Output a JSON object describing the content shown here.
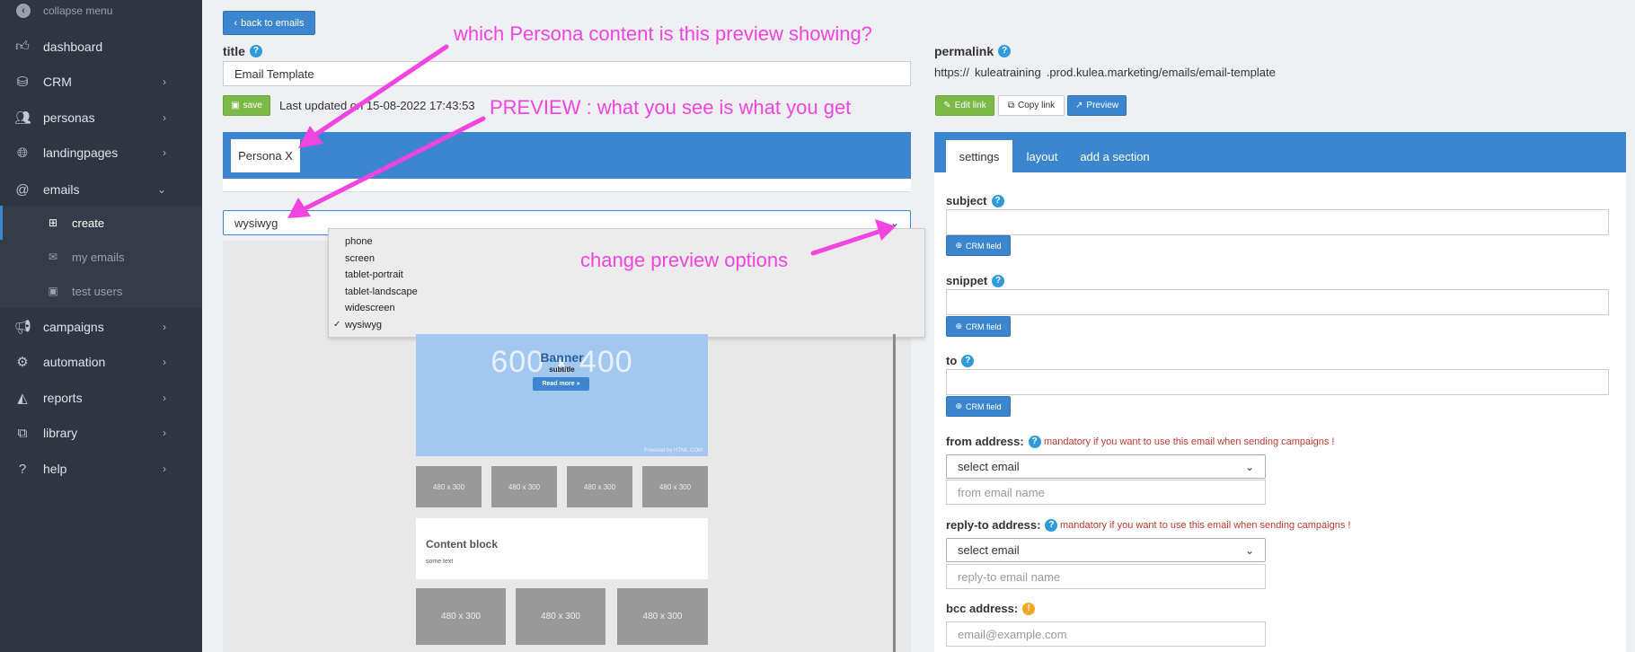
{
  "sidebar": {
    "collapse_label": "collapse menu",
    "items": [
      {
        "label": "dashboard",
        "icon": "thumbs-up-icon",
        "chevron": ""
      },
      {
        "label": "CRM",
        "icon": "database-icon",
        "chevron": "›"
      },
      {
        "label": "personas",
        "icon": "users-icon",
        "chevron": "›"
      },
      {
        "label": "landingpages",
        "icon": "globe-icon",
        "chevron": "›"
      },
      {
        "label": "emails",
        "icon": "at-icon",
        "chevron": "⌄"
      },
      {
        "label": "create",
        "icon": "plus-square-icon",
        "chevron": ""
      },
      {
        "label": "my emails",
        "icon": "envelope-icon",
        "chevron": ""
      },
      {
        "label": "test users",
        "icon": "id-card-icon",
        "chevron": ""
      },
      {
        "label": "campaigns",
        "icon": "megaphone-icon",
        "chevron": "›"
      },
      {
        "label": "automation",
        "icon": "gears-icon",
        "chevron": "›"
      },
      {
        "label": "reports",
        "icon": "area-chart-icon",
        "chevron": "›"
      },
      {
        "label": "library",
        "icon": "copy-icon",
        "chevron": "›"
      },
      {
        "label": "help",
        "icon": "question-circle-icon",
        "chevron": "›"
      }
    ]
  },
  "main": {
    "back_label": "back to emails",
    "title_label": "title",
    "title_value": "Email Template",
    "save_label": "save",
    "last_updated": "Last updated on 15-08-2022 17:43:53",
    "persona_label": "Persona X",
    "preview_select": "wysiwyg",
    "preview_options": [
      "phone",
      "screen",
      "tablet-portrait",
      "tablet-landscape",
      "widescreen",
      "wysiwyg"
    ],
    "preview_selected_mark": "✓",
    "banner": {
      "size_text": "600 x 400",
      "title": "Banner",
      "subtitle": "subtitle",
      "button": "Read more »",
      "footer": "Powered by HTML.COM"
    },
    "thumbs_small": [
      "480 x 300",
      "480 x 300",
      "480 x 300",
      "480 x 300"
    ],
    "content_block_title": "Content block",
    "content_block_text": "some text",
    "thumbs_large": [
      "480 x 300",
      "480 x 300",
      "480 x 300"
    ]
  },
  "right": {
    "permalink_label": "permalink",
    "permalink_prefix": "https://",
    "permalink_sub": "kuleatraining",
    "permalink_rest": ".prod.kulea.marketing/emails/email-template",
    "edit_link": "Edit link",
    "copy_link": "Copy link",
    "preview": "Preview",
    "tabs": [
      "settings",
      "layout",
      "add a section"
    ],
    "subject_label": "subject",
    "snippet_label": "snippet",
    "to_label": "to",
    "crm_field": "CRM field",
    "from_label": "from address:",
    "from_note": "mandatory if you want to use this email when sending campaigns !",
    "select_email": "select email",
    "from_name_placeholder": "from email name",
    "reply_label": "reply-to address:",
    "reply_note": "mandatory if you want to use this email when sending campaigns !",
    "reply_name_placeholder": "reply-to email name",
    "bcc_label": "bcc address:",
    "bcc_placeholder": "email@example.com"
  },
  "annotations": {
    "persona_question": "which Persona content is this preview showing?",
    "preview_note": "PREVIEW : what you see is what you get",
    "options_note": "change preview options",
    "color": "#f244e0"
  },
  "colors": {
    "sidebar": "#2f3542",
    "accent": "#3c86d0",
    "save": "#7cb947",
    "mandatory": "#c0392b"
  }
}
